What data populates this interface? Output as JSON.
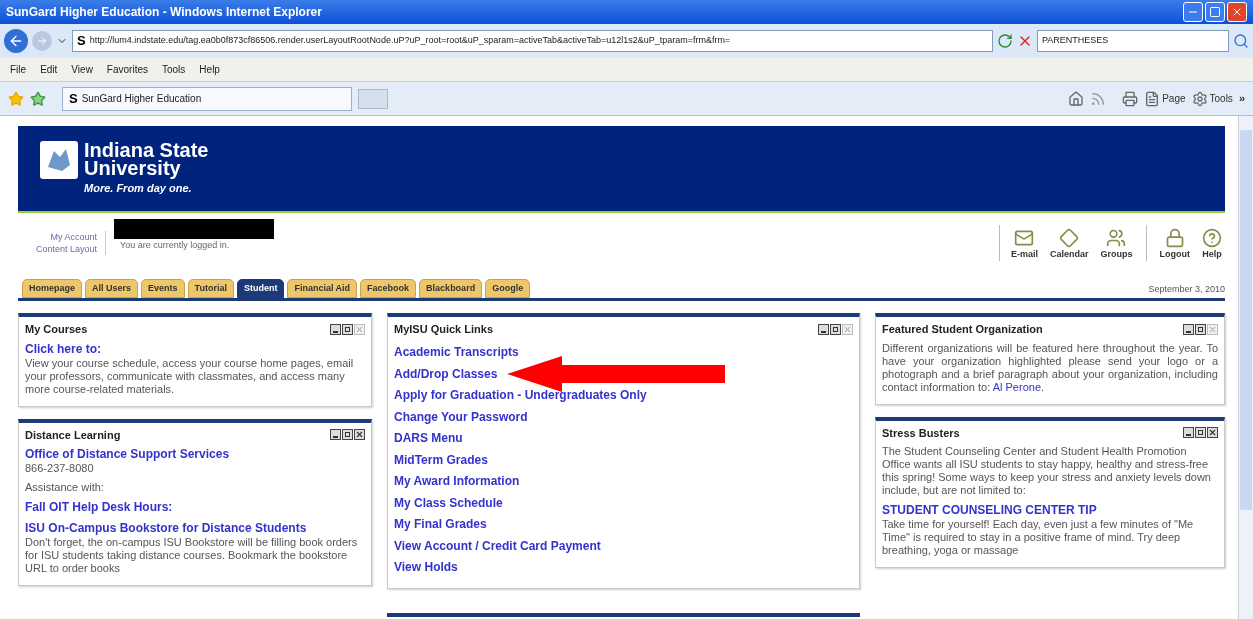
{
  "window": {
    "title": "SunGard Higher Education - Windows Internet Explorer"
  },
  "address": {
    "favicon": "S",
    "url": "http://lum4.indstate.edu/tag.ea0b0f873cf86506.render.userLayoutRootNode.uP?uP_root=root&uP_sparam=activeTab&activeTab=u12l1s2&uP_tparam=frm&frm=",
    "search": "PARENTHESES"
  },
  "menu": [
    "File",
    "Edit",
    "View",
    "Favorites",
    "Tools",
    "Help"
  ],
  "favorites_bar": {
    "favicon": "S",
    "tab": "SunGard Higher Education",
    "page_button": "Page",
    "tools_button": "Tools",
    "more": "»"
  },
  "logo": {
    "line1": "Indiana State",
    "line2": "University",
    "tagline": "More. From day one."
  },
  "account": {
    "links": [
      "My Account",
      "Content Layout"
    ],
    "status": "You are currently logged in."
  },
  "header_icons": [
    {
      "kind": "mail",
      "label": "E-mail"
    },
    {
      "kind": "calendar",
      "label": "Calendar"
    },
    {
      "kind": "groups",
      "label": "Groups"
    },
    {
      "kind": "logout",
      "label": "Logout"
    },
    {
      "kind": "help",
      "label": "Help"
    }
  ],
  "tabs": [
    {
      "label": "Homepage",
      "selected": false
    },
    {
      "label": "All Users",
      "selected": false
    },
    {
      "label": "Events",
      "selected": false
    },
    {
      "label": "Tutorial",
      "selected": false
    },
    {
      "label": "Student",
      "selected": true
    },
    {
      "label": "Financial Aid",
      "selected": false
    },
    {
      "label": "Facebook",
      "selected": false
    },
    {
      "label": "Blackboard",
      "selected": false
    },
    {
      "label": "Google",
      "selected": false
    }
  ],
  "date": "September 3, 2010",
  "columns": [
    [
      {
        "title": "My Courses",
        "removable": false,
        "items": [
          {
            "kind": "link",
            "text": "Click here to:"
          },
          {
            "kind": "text",
            "text": "View your course schedule, access your course home pages, email your professors, communicate with classmates, and access many more course-related materials."
          }
        ]
      },
      {
        "title": "Distance Learning",
        "removable": true,
        "items": [
          {
            "kind": "link",
            "text": "Office of Distance Support Services"
          },
          {
            "kind": "text",
            "text": "866-237-8080"
          },
          {
            "kind": "gaptext",
            "text": "Assistance with:"
          },
          {
            "kind": "gaplink",
            "text": "Fall OIT Help Desk Hours:"
          },
          {
            "kind": "gaplink",
            "text": "ISU On-Campus Bookstore for Distance Students"
          },
          {
            "kind": "text",
            "text": "Don't forget, the on-campus ISU Bookstore will be filling book orders for ISU students taking distance courses. Bookmark the bookstore URL to order books"
          }
        ]
      }
    ],
    [
      {
        "title": "MyISU Quick Links",
        "removable": false,
        "items": [
          {
            "kind": "quicklink",
            "text": "Academic Transcripts",
            "arrow": false
          },
          {
            "kind": "quicklink",
            "text": "Add/Drop Classes",
            "arrow": true
          },
          {
            "kind": "quicklink",
            "text": "Apply for Graduation - Undergraduates Only",
            "arrow": false
          },
          {
            "kind": "quicklink",
            "text": "Change Your Password",
            "arrow": false
          },
          {
            "kind": "quicklink",
            "text": "DARS Menu",
            "arrow": false
          },
          {
            "kind": "quicklink",
            "text": "MidTerm Grades",
            "arrow": false
          },
          {
            "kind": "quicklink",
            "text": "My Award Information",
            "arrow": false
          },
          {
            "kind": "quicklink",
            "text": "My Class Schedule",
            "arrow": false
          },
          {
            "kind": "quicklink",
            "text": "My Final Grades",
            "arrow": false
          },
          {
            "kind": "quicklink",
            "text": "View Account / Credit Card Payment",
            "arrow": false
          },
          {
            "kind": "quicklink",
            "text": "View Holds",
            "arrow": false
          }
        ]
      },
      {
        "kind": "empty"
      }
    ],
    [
      {
        "title": "Featured Student Organization",
        "removable": false,
        "items": [
          {
            "kind": "justified",
            "text": "Different organizations will be featured here throughout the year. To have your organization highlighted please send your logo or a photograph and a brief paragraph about your organization, including contact information to:",
            "link": "Al Perone",
            "after": "."
          }
        ]
      },
      {
        "title": "Stress Busters",
        "removable": true,
        "items": [
          {
            "kind": "text",
            "text": "The Student Counseling Center and Student Health Promotion Office wants all ISU students to stay happy, healthy and stress-free this spring! Some ways to keep your stress and anxiety levels down include, but are not limited to:"
          },
          {
            "kind": "gaplink",
            "text": "STUDENT COUNSELING CENTER TIP"
          },
          {
            "kind": "text",
            "text": "Take time for yourself! Each day, even just a few minutes of \"Me Time\" is required to stay in a positive frame of mind. Try deep breathing, yoga or massage"
          }
        ]
      }
    ]
  ]
}
